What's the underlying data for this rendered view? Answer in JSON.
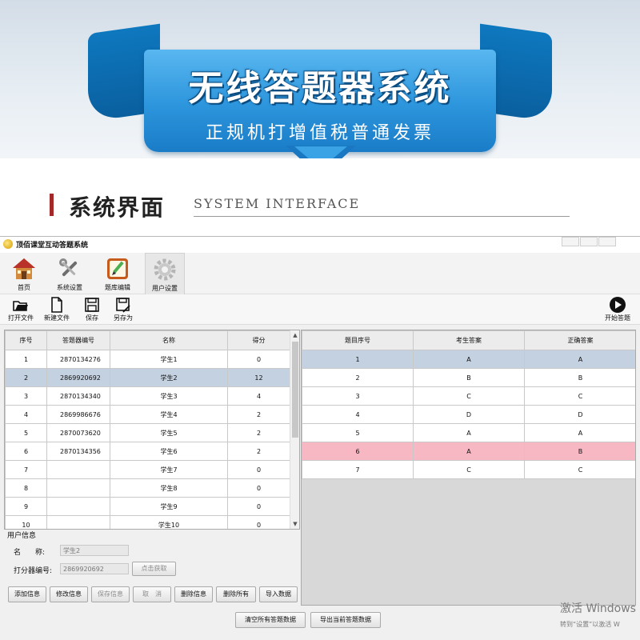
{
  "banner": {
    "title": "无线答题器系统",
    "subtitle": "正规机打增值税普通发票"
  },
  "section": {
    "title_cn": "系统界面",
    "title_en": "SYSTEM INTERFACE"
  },
  "app": {
    "title": "顶佰课堂互动答题系统",
    "tabs": [
      {
        "label": "首页",
        "icon": "home-icon"
      },
      {
        "label": "系统设置",
        "icon": "wrench-icon"
      },
      {
        "label": "题库编辑",
        "icon": "edit-board-icon"
      },
      {
        "label": "用户设置",
        "icon": "gear-icon"
      }
    ],
    "toolbar": {
      "open": "打开文件",
      "new": "新建文件",
      "save": "保存",
      "save_as": "另存为",
      "start": "开始答题"
    }
  },
  "left_table": {
    "headers": [
      "序号",
      "答题器编号",
      "名称",
      "得分"
    ],
    "rows": [
      [
        "1",
        "2870134276",
        "学生1",
        "0"
      ],
      [
        "2",
        "2869920692",
        "学生2",
        "12"
      ],
      [
        "3",
        "2870134340",
        "学生3",
        "4"
      ],
      [
        "4",
        "2869986676",
        "学生4",
        "2"
      ],
      [
        "5",
        "2870073620",
        "学生5",
        "2"
      ],
      [
        "6",
        "2870134356",
        "学生6",
        "2"
      ],
      [
        "7",
        "",
        "学生7",
        "0"
      ],
      [
        "8",
        "",
        "学生8",
        "0"
      ],
      [
        "9",
        "",
        "学生9",
        "0"
      ],
      [
        "10",
        "",
        "学生10",
        "0"
      ]
    ],
    "selected_row": 1
  },
  "right_table": {
    "headers": [
      "题目序号",
      "考生答案",
      "正确答案"
    ],
    "rows": [
      [
        "1",
        "A",
        "A"
      ],
      [
        "2",
        "B",
        "B"
      ],
      [
        "3",
        "C",
        "C"
      ],
      [
        "4",
        "D",
        "D"
      ],
      [
        "5",
        "A",
        "A"
      ],
      [
        "6",
        "A",
        "B"
      ],
      [
        "7",
        "C",
        "C"
      ]
    ],
    "selected_row": 0,
    "wrong_row": 5
  },
  "user_info": {
    "title": "用户信息",
    "name_label": "名　　称:",
    "name_value": "学生2",
    "id_label": "打分器编号:",
    "id_value": "2869920692",
    "fetch_button": "点击获取"
  },
  "buttons": {
    "add": "添加信息",
    "edit": "修改信息",
    "save": "保存信息",
    "cancel": "取　消",
    "delete": "删除信息",
    "delete_all": "删除所有",
    "import": "导入数据",
    "clear_all": "清空所有答题数据",
    "export": "导出当前答题数据"
  },
  "watermark": {
    "line1": "激活 Windows",
    "line2": "转到“设置”以激活 W"
  },
  "colors": {
    "selected_row": "#c3d1e0",
    "wrong_row": "#f7b8c3",
    "banner_blue": "#2c95dc",
    "section_bar": "#a32828"
  }
}
